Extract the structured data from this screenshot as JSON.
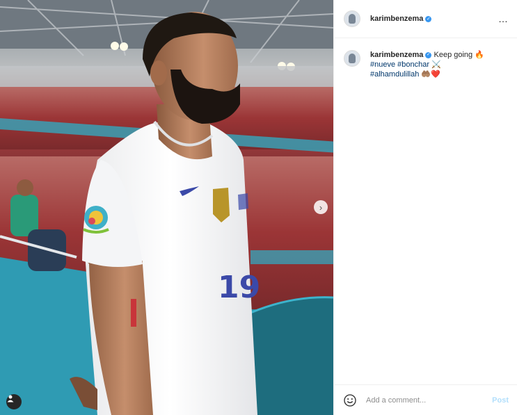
{
  "post": {
    "username": "karimbenzema",
    "verified": true,
    "more_icon": "…",
    "caption": {
      "username": "karimbenzema",
      "text": "Keep going",
      "fire_emoji": "🔥",
      "hashtags": [
        "#nueve",
        "#bonchar"
      ],
      "swords_emoji": "⚔️",
      "hashtag_last": "#alhamdulillah",
      "hands_emoji": "🤲🏽",
      "heart_emoji": "❤️"
    },
    "jersey_number": "19"
  },
  "comment": {
    "placeholder": "Add a comment...",
    "post_label": "Post"
  },
  "colors": {
    "link": "#00376b",
    "verified": "#3897f0",
    "post_disabled": "#b2dffc",
    "stadium_teal": "#2c8fa6",
    "jersey_blue": "#3b49a8"
  },
  "icons": [
    "chevron-right-icon",
    "user-tag-icon",
    "verified-icon",
    "more-icon",
    "emoji-icon"
  ]
}
